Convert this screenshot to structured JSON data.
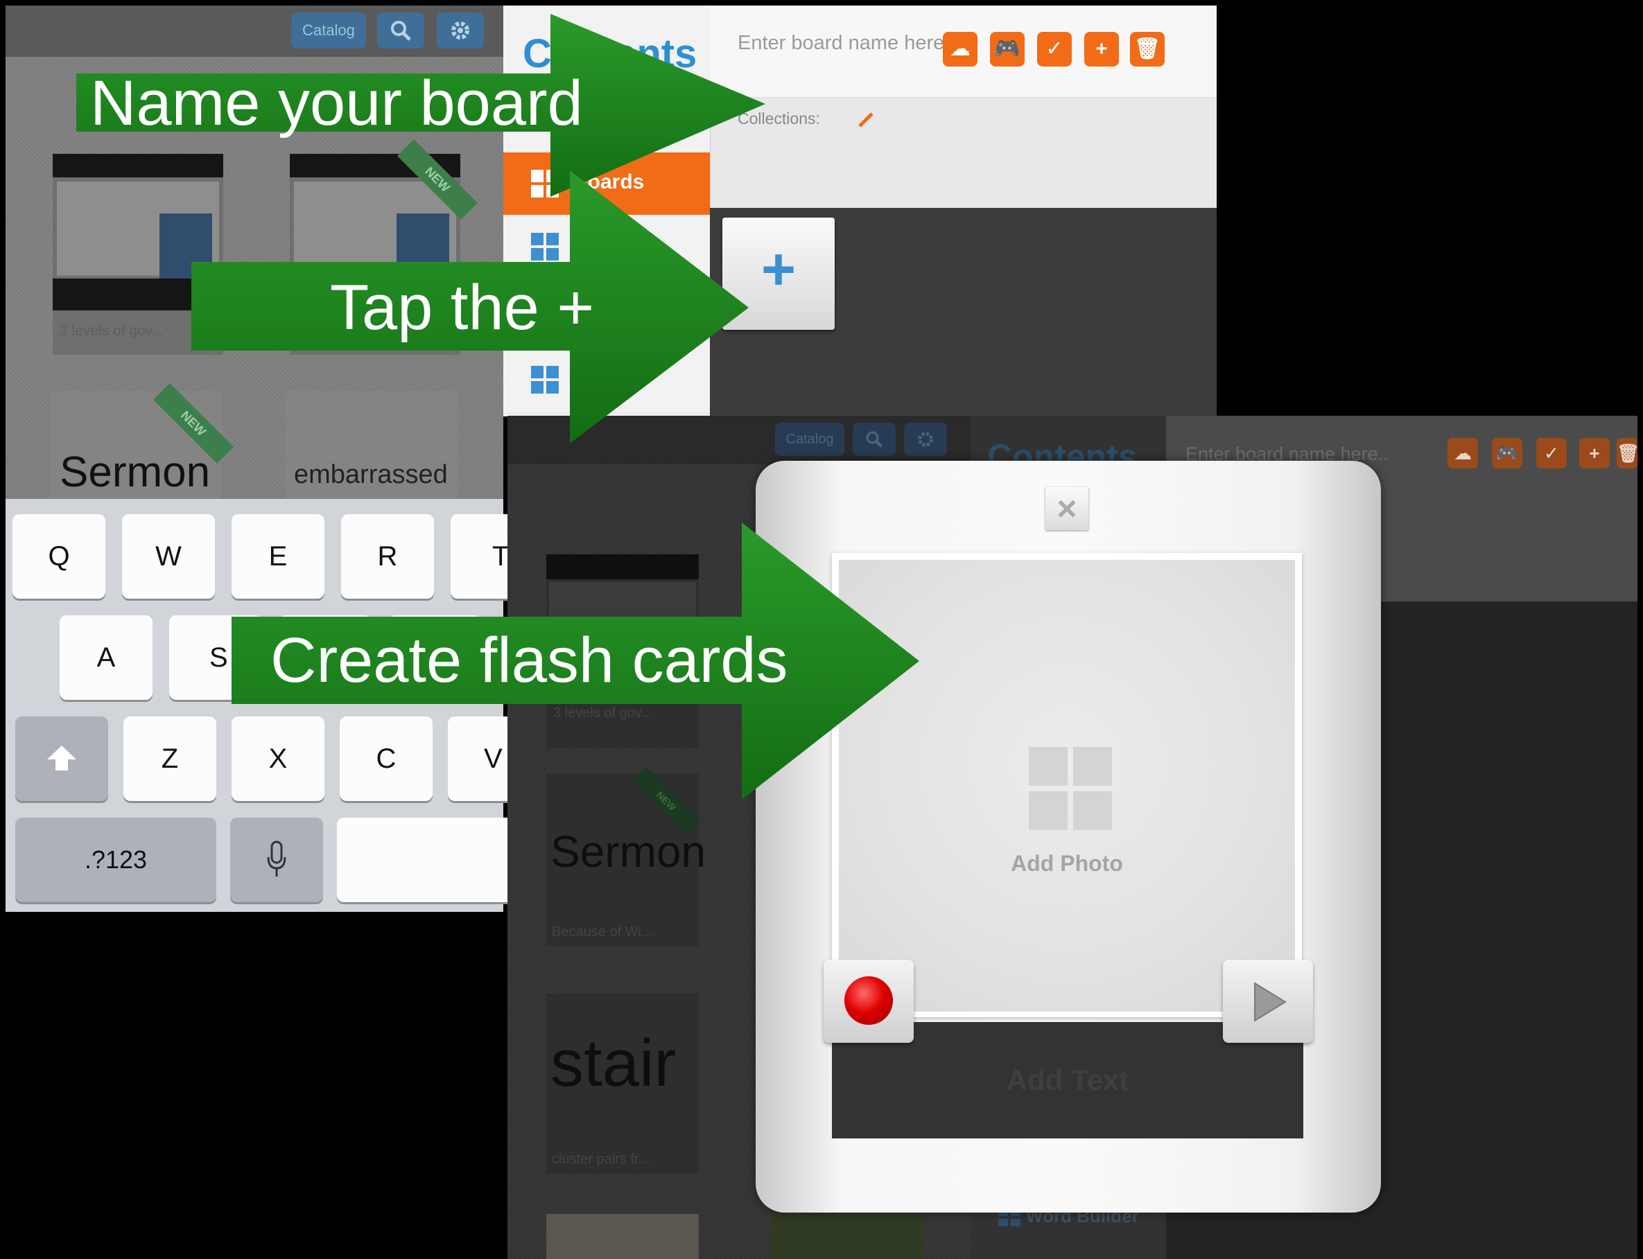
{
  "screen1": {
    "toolbar": {
      "catalog": "Catalog"
    },
    "cards": [
      {
        "label": "3 levels of gov...",
        "badge": ""
      },
      {
        "label": "",
        "badge": "NEW"
      }
    ],
    "words": [
      {
        "word": "Sermon",
        "badge": "NEW"
      },
      {
        "word": "embarrassed",
        "badge": ""
      }
    ],
    "sidebar": {
      "title": "Contents",
      "boards_label": "Boards"
    },
    "header": {
      "board_name_placeholder": "Enter board name here..",
      "collections_label": "Collections:"
    },
    "plus_label": "+",
    "keyboard": {
      "row1": [
        "Q",
        "W",
        "E",
        "R",
        "T"
      ],
      "row2": [
        "A",
        "S"
      ],
      "row3": [
        "Z",
        "X",
        "C",
        "V"
      ],
      "numbers_key": ".?123"
    }
  },
  "screen2": {
    "toolbar": {
      "catalog": "Catalog"
    },
    "sidebar": {
      "title": "Contents",
      "word_builder": "Word Builder"
    },
    "header": {
      "board_name_placeholder": "Enter board name here.."
    },
    "cards": [
      {
        "word": "",
        "sub": "3 levels of gov..."
      },
      {
        "word": "Sermon",
        "sub": "Because of Wi...",
        "badge": "NEW"
      },
      {
        "word": "stair",
        "sub": "cluster pairs fr..."
      }
    ]
  },
  "modal": {
    "close_label": "×",
    "add_photo": "Add Photo",
    "add_text": "Add Text"
  },
  "callouts": {
    "name_board": "Name your board",
    "tap_plus": "Tap the +",
    "create_cards": "Create flash cards",
    "color": "#1f8a1f"
  },
  "icons": [
    "search-icon",
    "gear-icon",
    "upload-icon",
    "gamepad-icon",
    "check-icon",
    "plus-icon",
    "trash-icon",
    "grid-icon",
    "pencil-icon",
    "shift-icon",
    "microphone-icon",
    "record-icon",
    "play-icon",
    "close-icon"
  ]
}
